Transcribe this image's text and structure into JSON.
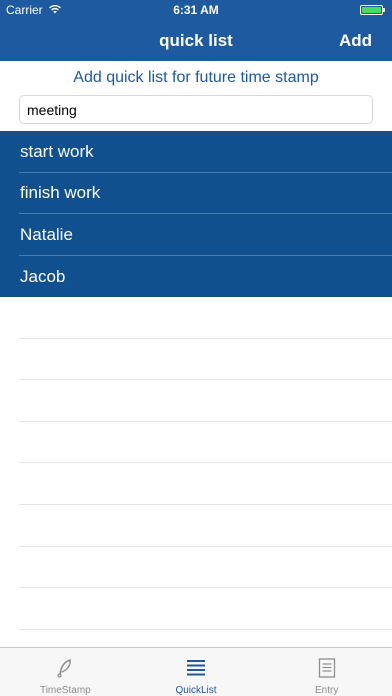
{
  "status_bar": {
    "carrier": "Carrier",
    "time": "6:31 AM",
    "battery_level": 1.0,
    "battery_color": "#4cd964"
  },
  "nav": {
    "title": "quick list",
    "add_label": "Add",
    "background": "#1e5aa0"
  },
  "prompt": "Add quick list for future time stamp",
  "input": {
    "value": "meeting",
    "placeholder": ""
  },
  "items": [
    {
      "label": "start work"
    },
    {
      "label": "finish work"
    },
    {
      "label": "Natalie"
    },
    {
      "label": "Jacob"
    }
  ],
  "tabs": [
    {
      "label": "TimeStamp",
      "icon": "quill-icon",
      "active": false
    },
    {
      "label": "QuickList",
      "icon": "list-icon",
      "active": true
    },
    {
      "label": "Entry",
      "icon": "document-icon",
      "active": false
    }
  ],
  "colors": {
    "accent": "#1e5aa0",
    "list_row": "#11508e",
    "tab_inactive": "#8e8e8e"
  }
}
